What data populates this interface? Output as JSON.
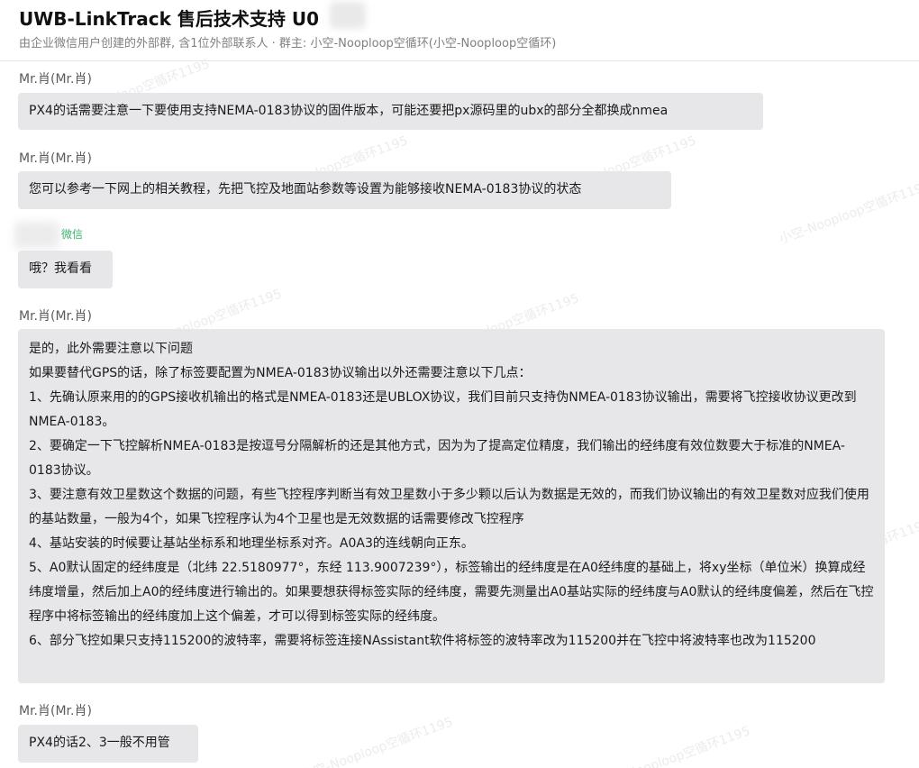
{
  "header": {
    "title": "UWB-LinkTrack 售后技术支持 U0",
    "subtitle": "由企业微信用户创建的外部群, 含1位外部联系人 · 群主: 小空-Nooploop空循环(小空-Nooploop空循环)"
  },
  "watermark_text": "小空-Nooploop空循环1195",
  "messages": [
    {
      "sender": "Mr.肖(Mr.肖)",
      "lines": [
        "PX4的话需要注意一下要使用支持NEMA-0183协议的固件版本，可能还要把px源码里的ubx的部分全都换成nmea"
      ]
    },
    {
      "sender": "Mr.肖(Mr.肖)",
      "lines": [
        "您可以参考一下网上的相关教程，先把飞控及地面站参数等设置为能够接收NEMA-0183协议的状态"
      ]
    },
    {
      "sender": "",
      "sender_tag": "微信",
      "lines": [
        "哦？我看看"
      ]
    },
    {
      "sender": "Mr.肖(Mr.肖)",
      "lines": [
        "是的，此外需要注意以下问题",
        "如果要替代GPS的话，除了标签要配置为NMEA-0183协议输出以外还需要注意以下几点：",
        "1、先确认原来用的的GPS接收机输出的格式是NMEA-0183还是UBLOX协议，我们目前只支持伪NMEA-0183协议输出，需要将飞控接收协议更改到NMEA-0183。",
        "2、要确定一下飞控解析NMEA-0183是按逗号分隔解析的还是其他方式，因为为了提高定位精度，我们输出的经纬度有效位数要大于标准的NMEA-0183协议。",
        "3、要注意有效卫星数这个数据的问题，有些飞控程序判断当有效卫星数小于多少颗以后认为数据是无效的，而我们协议输出的有效卫星数对应我们使用的基站数量，一般为4个，如果飞控程序认为4个卫星也是无效数据的话需要修改飞控程序",
        "4、基站安装的时候要让基站坐标系和地理坐标系对齐。A0A3的连线朝向正东。",
        "5、A0默认固定的经纬度是（北纬 22.5180977°，东经 113.9007239°），标签输出的经纬度是在A0经纬度的基础上，将xy坐标（单位米）换算成经纬度增量，然后加上A0的经纬度进行输出的。如果要想获得标签实际的经纬度，需要先测量出A0基站实际的经纬度与A0默认的经纬度偏差，然后在飞控程序中将标签输出的经纬度加上这个偏差，才可以得到标签实际的经纬度。",
        "6、部分飞控如果只支持115200的波特率，需要将标签连接NAssistant软件将标签的波特率改为115200并在飞控中将波特率也改为115200"
      ]
    },
    {
      "sender": "Mr.肖(Mr.肖)",
      "lines": [
        "PX4的话2、3一般不用管"
      ]
    }
  ]
}
